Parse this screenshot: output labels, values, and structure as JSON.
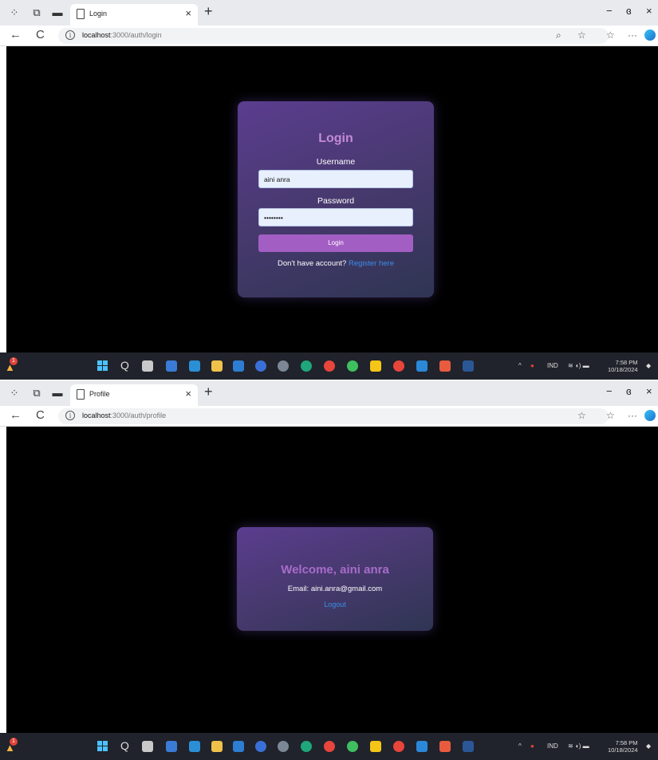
{
  "screens": [
    {
      "tab_title": "Login",
      "url_host": "localhost",
      "url_path": ":3000/auth/login",
      "heading": "Login",
      "username_label": "Username",
      "username_value": "aini anra",
      "password_label": "Password",
      "password_value": "••••••••",
      "button_label": "Login",
      "footer_text": "Don't have account?",
      "footer_link": "Register here",
      "time": "7:58 PM",
      "date": "10/18/2024",
      "lang": "IND"
    },
    {
      "tab_title": "Profile",
      "url_host": "localhost",
      "url_path": ":3000/auth/profile",
      "heading": "Welcome, aini anra",
      "email_text": "Email: aini.anra@gmail.com",
      "logout_label": "Logout",
      "time": "7:58 PM",
      "date": "10/18/2024",
      "lang": "IND"
    }
  ],
  "icons": {
    "tab_close": "×",
    "new_tab": "+",
    "minimize": "−",
    "restore": "ɞ",
    "close": "×",
    "back": "←",
    "reload": "C",
    "more": "···",
    "search": "Q",
    "chevron": "^"
  },
  "notification_count": "1",
  "colors": {
    "card_heading": "#c48ad6",
    "login_button": "#a35ec4",
    "link": "#3c8de8",
    "taskbar": "#20232b"
  }
}
